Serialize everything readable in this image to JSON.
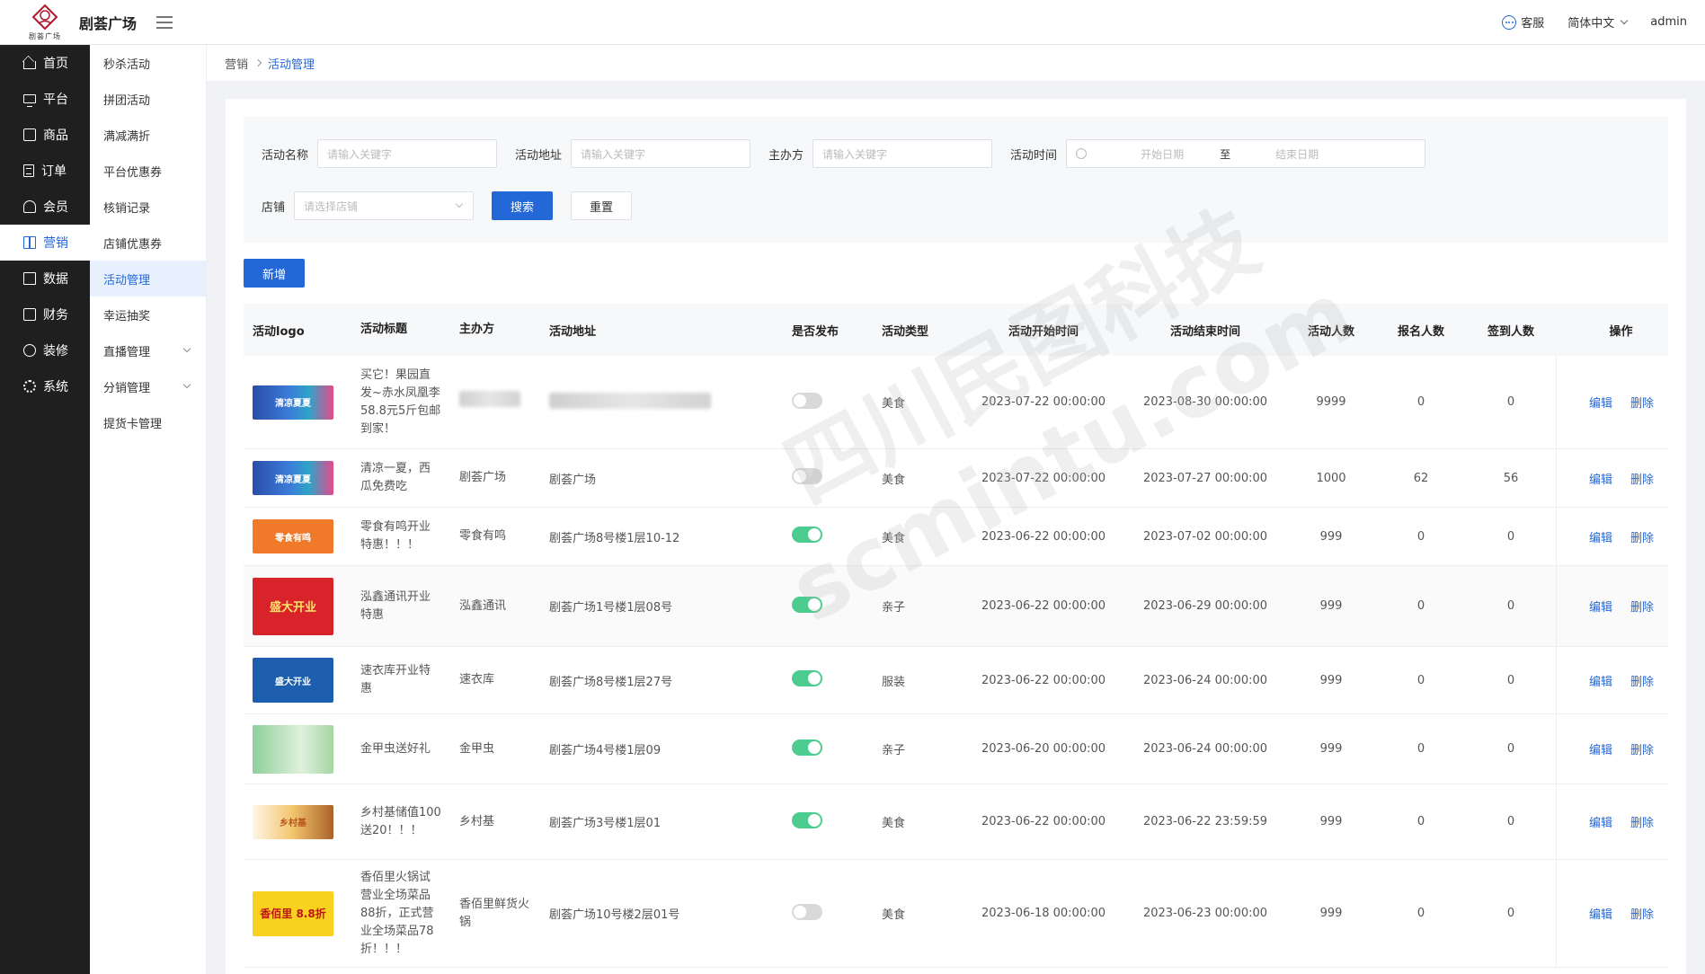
{
  "header": {
    "app_title": "剧荟广场",
    "logo_sub": "剧荟广场",
    "customer_service": "客服",
    "language": "简体中文",
    "user": "admin"
  },
  "sidenav": [
    {
      "label": "首页",
      "icon": "home-icon"
    },
    {
      "label": "平台",
      "icon": "monitor-icon"
    },
    {
      "label": "商品",
      "icon": "bag-icon"
    },
    {
      "label": "订单",
      "icon": "document-icon"
    },
    {
      "label": "会员",
      "icon": "users-icon"
    },
    {
      "label": "营销",
      "icon": "gift-icon",
      "active": true
    },
    {
      "label": "数据",
      "icon": "chart-icon"
    },
    {
      "label": "财务",
      "icon": "wallet-icon"
    },
    {
      "label": "装修",
      "icon": "brush-icon"
    },
    {
      "label": "系统",
      "icon": "gear-icon"
    }
  ],
  "submenu": [
    {
      "label": "秒杀活动"
    },
    {
      "label": "拼团活动"
    },
    {
      "label": "满减满折"
    },
    {
      "label": "平台优惠券"
    },
    {
      "label": "核销记录"
    },
    {
      "label": "店铺优惠券"
    },
    {
      "label": "活动管理",
      "active": true
    },
    {
      "label": "幸运抽奖"
    },
    {
      "label": "直播管理",
      "expandable": true
    },
    {
      "label": "分销管理",
      "expandable": true
    },
    {
      "label": "提货卡管理"
    }
  ],
  "breadcrumb": {
    "parent": "营销",
    "current": "活动管理"
  },
  "filter": {
    "name_label": "活动名称",
    "name_placeholder": "请输入关键字",
    "addr_label": "活动地址",
    "addr_placeholder": "请输入关键字",
    "org_label": "主办方",
    "org_placeholder": "请输入关键字",
    "time_label": "活动时间",
    "start_placeholder": "开始日期",
    "to": "至",
    "end_placeholder": "结束日期",
    "shop_label": "店铺",
    "shop_placeholder": "请选择店铺",
    "search": "搜索",
    "reset": "重置"
  },
  "add_button": "新增",
  "table": {
    "headers": {
      "logo": "活动logo",
      "title": "活动标题",
      "org": "主办方",
      "addr": "活动地址",
      "published": "是否发布",
      "type": "活动类型",
      "start": "活动开始时间",
      "end": "活动结束时间",
      "capacity": "活动人数",
      "registered": "报名人数",
      "signed": "签到人数",
      "ops": "操作"
    },
    "edit": "编辑",
    "delete": "删除",
    "rows": [
      {
        "logo": "清凉夏夏",
        "title": "买它！果园直发~赤水凤凰李58.8元5斤包邮到家！",
        "org": "",
        "addr": "",
        "published": false,
        "type": "美食",
        "start": "2023-07-22 00:00:00",
        "end": "2023-08-30 00:00:00",
        "capacity": "9999",
        "registered": "0",
        "signed": "0"
      },
      {
        "logo": "清凉夏夏",
        "title": "清凉一夏，西瓜免费吃",
        "org": "剧荟广场",
        "addr": "剧荟广场",
        "published": false,
        "type": "美食",
        "start": "2023-07-22 00:00:00",
        "end": "2023-07-27 00:00:00",
        "capacity": "1000",
        "registered": "62",
        "signed": "56"
      },
      {
        "logo": "零食有鸣",
        "title": "零食有鸣开业特惠！！！",
        "org": "零食有鸣",
        "addr": "剧荟广场8号楼1层10-12",
        "published": true,
        "type": "美食",
        "start": "2023-06-22 00:00:00",
        "end": "2023-07-02 00:00:00",
        "capacity": "999",
        "registered": "0",
        "signed": "0"
      },
      {
        "logo": "盛大开业",
        "title": "泓鑫通讯开业特惠",
        "org": "泓鑫通讯",
        "addr": "剧荟广场1号楼1层08号",
        "published": true,
        "type": "亲子",
        "start": "2023-06-22 00:00:00",
        "end": "2023-06-29 00:00:00",
        "capacity": "999",
        "registered": "0",
        "signed": "0"
      },
      {
        "logo": "盛大开业",
        "title": "速衣库开业特惠",
        "org": "速衣库",
        "addr": "剧荟广场8号楼1层27号",
        "published": true,
        "type": "服装",
        "start": "2023-06-22 00:00:00",
        "end": "2023-06-24 00:00:00",
        "capacity": "999",
        "registered": "0",
        "signed": "0"
      },
      {
        "logo": "",
        "title": "金甲虫送好礼",
        "org": "金甲虫",
        "addr": "剧荟广场4号楼1层09",
        "published": true,
        "type": "亲子",
        "start": "2023-06-20 00:00:00",
        "end": "2023-06-24 00:00:00",
        "capacity": "999",
        "registered": "0",
        "signed": "0"
      },
      {
        "logo": "乡村基",
        "title": "乡村基储值100送20！！！",
        "org": "乡村基",
        "addr": "剧荟广场3号楼1层01",
        "published": true,
        "type": "美食",
        "start": "2023-06-22 00:00:00",
        "end": "2023-06-22 23:59:59",
        "capacity": "999",
        "registered": "0",
        "signed": "0"
      },
      {
        "logo": "香佰里 8.8折",
        "title": "香佰里火锅试营业全场菜品88折，正式营业全场菜品78折！！！",
        "org": "香佰里鲜货火锅",
        "addr": "剧荟广场10号楼2层01号",
        "published": false,
        "type": "美食",
        "start": "2023-06-18 00:00:00",
        "end": "2023-06-23 00:00:00",
        "capacity": "999",
        "registered": "0",
        "signed": "0"
      }
    ]
  },
  "watermark": [
    "四川民图科技",
    "scmintu.com"
  ],
  "colors": {
    "primary": "#2468d8",
    "toggle_on": "#4ccc8e",
    "sidebar": "#1f1f1f"
  }
}
